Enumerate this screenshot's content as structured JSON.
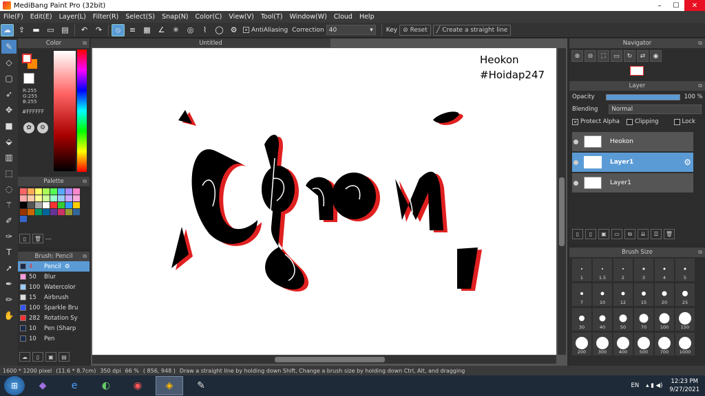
{
  "window": {
    "title": "MediBang Paint Pro (32bit)",
    "min": "–",
    "max": "☐",
    "close": "✕"
  },
  "menu": [
    "File(F)",
    "Edit(E)",
    "Layer(L)",
    "Filter(R)",
    "Select(S)",
    "Snap(N)",
    "Color(C)",
    "View(V)",
    "Tool(T)",
    "Window(W)",
    "Cloud",
    "Help"
  ],
  "toolbar": {
    "antialias_label": "AntiAliasing",
    "correction_label": "Correction",
    "correction_value": "40",
    "key_label": "Key",
    "reset_label": "Reset",
    "straight_label": "Create a straight line"
  },
  "color_panel": {
    "title": "Color",
    "r": "R:255",
    "g": "G:255",
    "b": "B:255",
    "hex": "#FFFFFF"
  },
  "palette_panel": {
    "title": "Palette",
    "dash": "---",
    "colors": [
      "#ff6666",
      "#ffaa55",
      "#ffff66",
      "#aaff55",
      "#55ff55",
      "#55aaff",
      "#aa88ff",
      "#ff88cc",
      "#ffaaaa",
      "#ffccaa",
      "#ffff99",
      "#ccff99",
      "#99ffcc",
      "#99ccff",
      "#ccaaff",
      "#ffaadd",
      "#000000",
      "#555555",
      "#aaaaaa",
      "#ffffff",
      "#ff3333",
      "#33cc33",
      "#3399ff",
      "#ffcc00",
      "#993300",
      "#cc6600",
      "#009966",
      "#006699",
      "#663399",
      "#cc3366",
      "#999933",
      "#336699",
      "#3366cc"
    ]
  },
  "brush_panel": {
    "title": "Brush: Pencil",
    "items": [
      {
        "size": "4",
        "name": "Pencil",
        "color": "#1a2a4a"
      },
      {
        "size": "50",
        "name": "Blur",
        "color": "#ff99dd"
      },
      {
        "size": "100",
        "name": "Watercolor",
        "color": "#99ccff"
      },
      {
        "size": "15",
        "name": "Airbrush",
        "color": "#dddddd"
      },
      {
        "size": "100",
        "name": "Sparkle Bru",
        "color": "#3355ff"
      },
      {
        "size": "282",
        "name": "Rotation Sy",
        "color": "#ff3333"
      },
      {
        "size": "10",
        "name": "Pen (Sharp",
        "color": "#1a2a4a"
      },
      {
        "size": "10",
        "name": "Pen",
        "color": "#1a2a4a"
      }
    ]
  },
  "document": {
    "tab": "Untitled",
    "text1": "Heokon",
    "text2": "#Hoidap247"
  },
  "navigator": {
    "title": "Navigator"
  },
  "layer_panel": {
    "title": "Layer",
    "opacity_label": "Opacity",
    "opacity_value": "100 %",
    "opacity": 1.0,
    "blending_label": "Blending",
    "blending_value": "Normal",
    "protect_alpha": "Protect Alpha",
    "clipping": "Clipping",
    "lock": "Lock",
    "layers": [
      {
        "name": "Heokon"
      },
      {
        "name": "Layer1"
      },
      {
        "name": "Layer1"
      }
    ]
  },
  "brush_size_panel": {
    "title": "Brush Size",
    "sizes": [
      "1",
      "1.5",
      "2",
      "3",
      "4",
      "5",
      "7",
      "10",
      "12",
      "15",
      "20",
      "25",
      "30",
      "40",
      "50",
      "70",
      "100",
      "150",
      "200",
      "300",
      "400",
      "500",
      "700",
      "1000"
    ]
  },
  "status": {
    "dims": "1600 * 1200 pixel",
    "physical": "(11.6 * 8.7cm)",
    "dpi": "350 dpi",
    "zoom": "66 %",
    "coords": "( 856, 948 )",
    "hint": "Draw a straight line by holding down Shift, Change a brush size by holding down Ctrl, Alt, and dragging"
  },
  "taskbar": {
    "lang": "EN",
    "time": "12:23 PM",
    "date": "9/27/2021"
  }
}
